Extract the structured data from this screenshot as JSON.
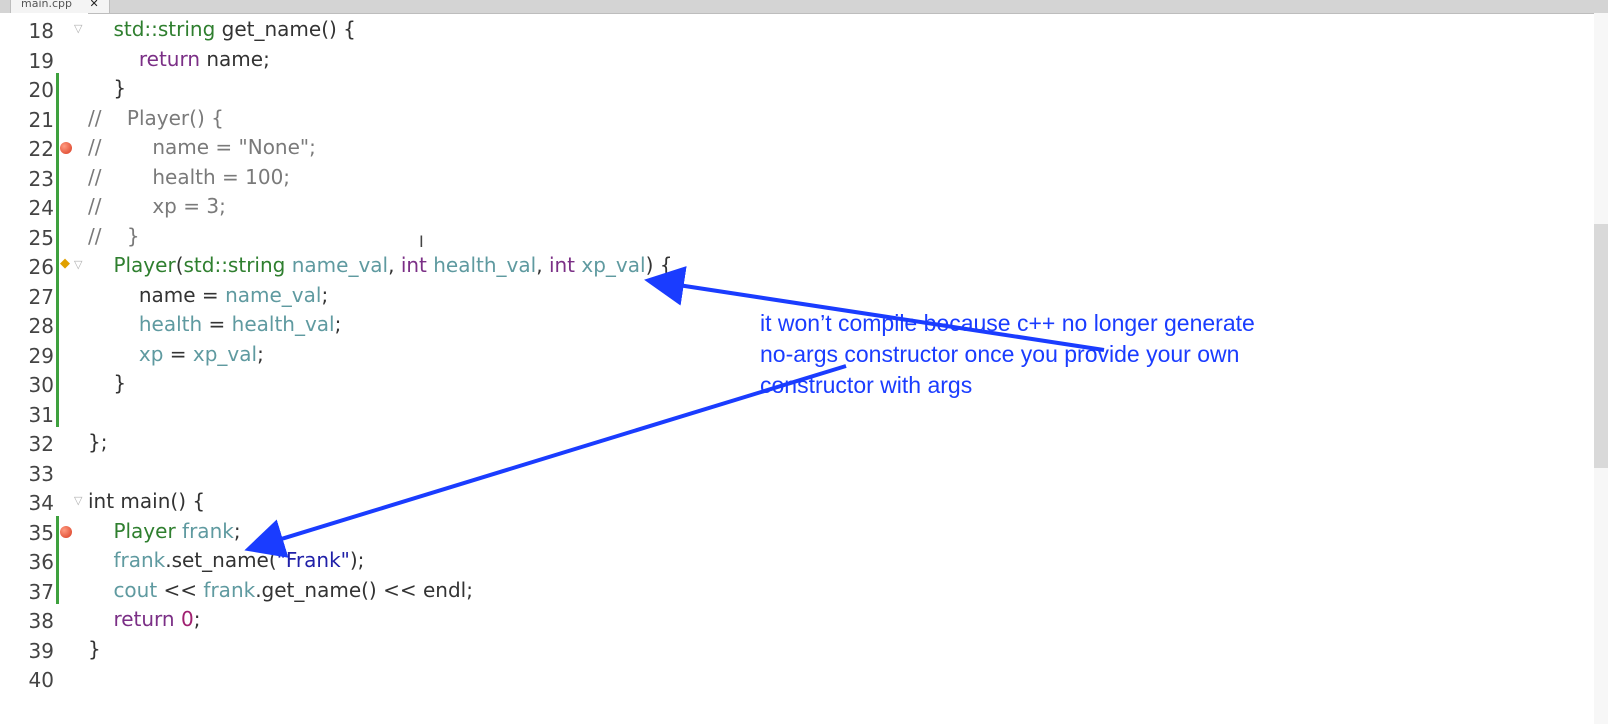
{
  "tab": {
    "label": "main.cpp",
    "close": "✕"
  },
  "lines": [
    {
      "n": "18",
      "fold": true,
      "tokens": [
        [
          "    ",
          "p"
        ],
        [
          "std::string",
          "ty"
        ],
        [
          " get_name() {",
          "p"
        ]
      ]
    },
    {
      "n": "19",
      "tokens": [
        [
          "        ",
          "p"
        ],
        [
          "return",
          "kw"
        ],
        [
          " name;",
          "p"
        ]
      ]
    },
    {
      "n": "20",
      "tokens": [
        [
          "    }",
          "p"
        ]
      ]
    },
    {
      "n": "21",
      "tokens": [
        [
          "//    Player() {",
          "cm"
        ]
      ]
    },
    {
      "n": "22",
      "breakpoint": true,
      "tokens": [
        [
          "//        name = \"None\";",
          "cm"
        ]
      ]
    },
    {
      "n": "23",
      "tokens": [
        [
          "//        health = 100;",
          "cm"
        ]
      ]
    },
    {
      "n": "24",
      "tokens": [
        [
          "//        xp = 3;",
          "cm"
        ]
      ]
    },
    {
      "n": "25",
      "tokens": [
        [
          "//    }",
          "cm"
        ]
      ]
    },
    {
      "n": "26",
      "fold": true,
      "exec": true,
      "tokens": [
        [
          "    ",
          "p"
        ],
        [
          "Player",
          "ty"
        ],
        [
          "(",
          "p"
        ],
        [
          "std::string",
          "ty"
        ],
        [
          " ",
          "p"
        ],
        [
          "name_val",
          "vr"
        ],
        [
          ", ",
          "p"
        ],
        [
          "int",
          "kw"
        ],
        [
          " ",
          "p"
        ],
        [
          "health_val",
          "vr"
        ],
        [
          ", ",
          "p"
        ],
        [
          "int",
          "kw"
        ],
        [
          " ",
          "p"
        ],
        [
          "xp_val",
          "vr"
        ],
        [
          ") {",
          "p"
        ]
      ]
    },
    {
      "n": "27",
      "tokens": [
        [
          "        name = ",
          "p"
        ],
        [
          "name_val",
          "vr"
        ],
        [
          ";",
          "p"
        ]
      ]
    },
    {
      "n": "28",
      "tokens": [
        [
          "        ",
          "p"
        ],
        [
          "health",
          "vr"
        ],
        [
          " = ",
          "p"
        ],
        [
          "health_val",
          "vr"
        ],
        [
          ";",
          "p"
        ]
      ]
    },
    {
      "n": "29",
      "tokens": [
        [
          "        ",
          "p"
        ],
        [
          "xp",
          "vr"
        ],
        [
          " = ",
          "p"
        ],
        [
          "xp_val",
          "vr"
        ],
        [
          ";",
          "p"
        ]
      ]
    },
    {
      "n": "30",
      "tokens": [
        [
          "    }",
          "p"
        ]
      ]
    },
    {
      "n": "31",
      "tokens": []
    },
    {
      "n": "32",
      "tokens": [
        [
          "};",
          "p"
        ]
      ]
    },
    {
      "n": "33",
      "tokens": []
    },
    {
      "n": "34",
      "fold": true,
      "tokens": [
        [
          "int main() {",
          "p"
        ]
      ]
    },
    {
      "n": "35",
      "breakpoint": true,
      "tokens": [
        [
          "    ",
          "p"
        ],
        [
          "Player",
          "ty"
        ],
        [
          " ",
          "p"
        ],
        [
          "frank",
          "vr"
        ],
        [
          ";",
          "p"
        ]
      ]
    },
    {
      "n": "36",
      "tokens": [
        [
          "    ",
          "p"
        ],
        [
          "frank",
          "vr"
        ],
        [
          ".set_name(",
          "p"
        ],
        [
          "\"Frank\"",
          "str"
        ],
        [
          ");",
          "p"
        ]
      ]
    },
    {
      "n": "37",
      "tokens": [
        [
          "    ",
          "p"
        ],
        [
          "cout",
          "vr"
        ],
        [
          " << ",
          "p"
        ],
        [
          "frank",
          "vr"
        ],
        [
          ".get_name() << endl;",
          "p"
        ]
      ]
    },
    {
      "n": "38",
      "tokens": [
        [
          "    ",
          "p"
        ],
        [
          "return",
          "kw"
        ],
        [
          " ",
          "p"
        ],
        [
          "0",
          "num"
        ],
        [
          ";",
          "p"
        ]
      ]
    },
    {
      "n": "39",
      "tokens": [
        [
          "}",
          "p"
        ]
      ]
    },
    {
      "n": "40",
      "tokens": []
    }
  ],
  "annotation": {
    "lines": [
      "it won’t compile because c++ no longer generate",
      "no-args constructor once you provide your own",
      "constructor with args"
    ],
    "color": "#1a3cff"
  },
  "colors": {
    "change_bar": "#3ea13e",
    "breakpoint": "#d83a20"
  }
}
